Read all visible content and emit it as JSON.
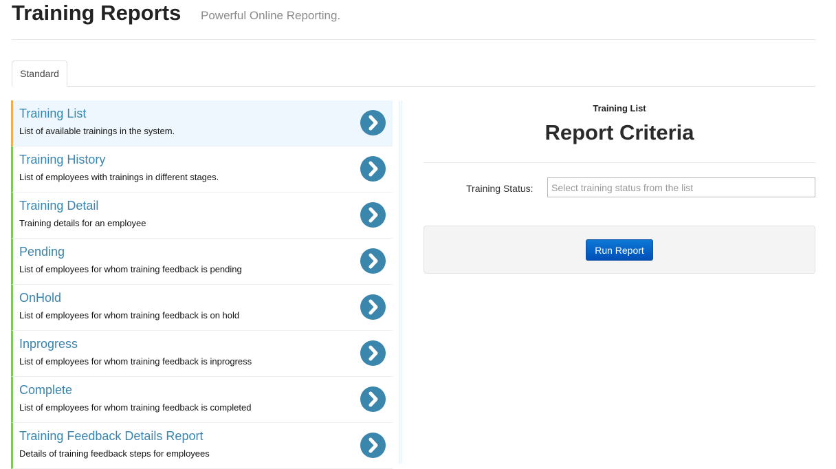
{
  "header": {
    "title": "Training Reports",
    "subtitle": "Powerful Online Reporting."
  },
  "tabs": [
    {
      "label": "Standard",
      "active": true
    }
  ],
  "reports": [
    {
      "title": "Training List",
      "description": "List of available trainings in the system.",
      "active": true,
      "icon": "chevron-right-circle-icon"
    },
    {
      "title": "Training History",
      "description": "List of employees with trainings in different stages.",
      "active": false,
      "icon": "chevron-right-circle-icon"
    },
    {
      "title": "Training Detail",
      "description": "Training details for an employee",
      "active": false,
      "icon": "chevron-right-circle-icon"
    },
    {
      "title": "Pending",
      "description": "List of employees for whom training feedback is pending",
      "active": false,
      "icon": "chevron-right-circle-icon"
    },
    {
      "title": "OnHold",
      "description": "List of employees for whom training feedback is on hold",
      "active": false,
      "icon": "chevron-right-circle-icon"
    },
    {
      "title": "Inprogress",
      "description": "List of employees for whom training feedback is inprogress",
      "active": false,
      "icon": "chevron-right-circle-icon"
    },
    {
      "title": "Complete",
      "description": "List of employees for whom training feedback is completed",
      "active": false,
      "icon": "chevron-right-circle-icon"
    },
    {
      "title": "Training Feedback Details Report",
      "description": "Details of training feedback steps for employees",
      "active": false,
      "icon": "chevron-right-circle-icon"
    }
  ],
  "criteria": {
    "report_name": "Training List",
    "heading": "Report Criteria",
    "fields": [
      {
        "label": "Training Status:",
        "value": "",
        "placeholder": "Select training status from the list"
      }
    ],
    "run_button": "Run Report"
  },
  "colors": {
    "active_accent": "#f0ad4e",
    "item_accent": "#7ec85a",
    "link_blue": "#3a84ad",
    "button_blue": "#0050b8"
  }
}
